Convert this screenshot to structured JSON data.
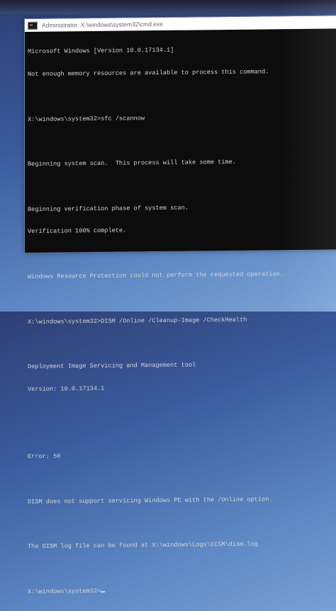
{
  "window": {
    "title": "Administrator: X:\\windows\\system32\\cmd.exe",
    "icon": "cmd-icon"
  },
  "console": {
    "lines": [
      "Microsoft Windows [Version 10.0.17134.1]",
      "Not enough memory resources are available to process this command.",
      "",
      "X:\\windows\\system32>sfc /scannow",
      "",
      "Beginning system scan.  This process will take some time.",
      "",
      "Beginning verification phase of system scan.",
      "Verification 100% complete.",
      "",
      "Windows Resource Protection could not perform the requested operation.",
      "",
      "X:\\windows\\system32>DISM /Online /Cleanup-Image /CheckHealth",
      "",
      "Deployment Image Servicing and Management tool",
      "Version: 10.0.17134.1",
      "",
      "",
      "Error: 50",
      "",
      "DISM does not support servicing Windows PE with the /Online option.",
      "",
      "The DISM log file can be found at X:\\windows\\Logs\\DISM\\dism.log",
      "",
      "X:\\windows\\system32>"
    ]
  }
}
